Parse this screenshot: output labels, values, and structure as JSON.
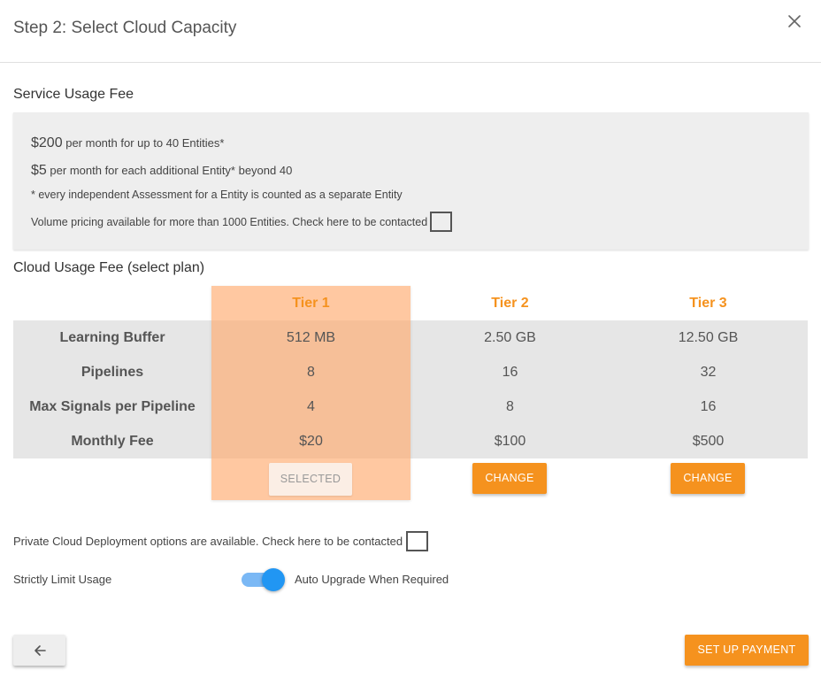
{
  "dialog": {
    "title": "Step 2: Select Cloud Capacity",
    "close_icon": "close-icon"
  },
  "service_fee": {
    "heading": "Service Usage Fee",
    "line1_price": "$200",
    "line1_text": "per month for up to 40 Entities*",
    "line2_price": "$5",
    "line2_text": "per month for each additional Entity* beyond 40",
    "note": "* every independent Assessment for a Entity is counted as a separate Entity",
    "volume_text": "Volume pricing available for more than 1000 Entities. Check here to be contacted",
    "volume_checked": false
  },
  "cloud_fee": {
    "heading": "Cloud Usage Fee (select plan)",
    "selected_tier": "Tier 1",
    "tiers": [
      "Tier 1",
      "Tier 2",
      "Tier 3"
    ],
    "rows": [
      {
        "label": "Learning Buffer",
        "values": [
          "512 MB",
          "2.50 GB",
          "12.50 GB"
        ]
      },
      {
        "label": "Pipelines",
        "values": [
          "8",
          "16",
          "32"
        ]
      },
      {
        "label": "Max Signals per Pipeline",
        "values": [
          "4",
          "8",
          "16"
        ]
      },
      {
        "label": "Monthly Fee",
        "values": [
          "$20",
          "$100",
          "$500"
        ]
      }
    ],
    "buttons": [
      "SELECTED",
      "CHANGE",
      "CHANGE"
    ]
  },
  "private_cloud": {
    "text": "Private Cloud Deployment options are available. Check here to be contacted",
    "checked": false
  },
  "usage_toggle": {
    "left_label": "Strictly Limit Usage",
    "right_label": "Auto Upgrade When Required",
    "state": "Auto Upgrade When Required"
  },
  "footer": {
    "back_icon": "arrow-left-icon",
    "payment_label": "SET UP PAYMENT"
  },
  "colors": {
    "accent": "#f5921e",
    "selected_column": "#ffc49e",
    "toggle": "#2196f3"
  }
}
